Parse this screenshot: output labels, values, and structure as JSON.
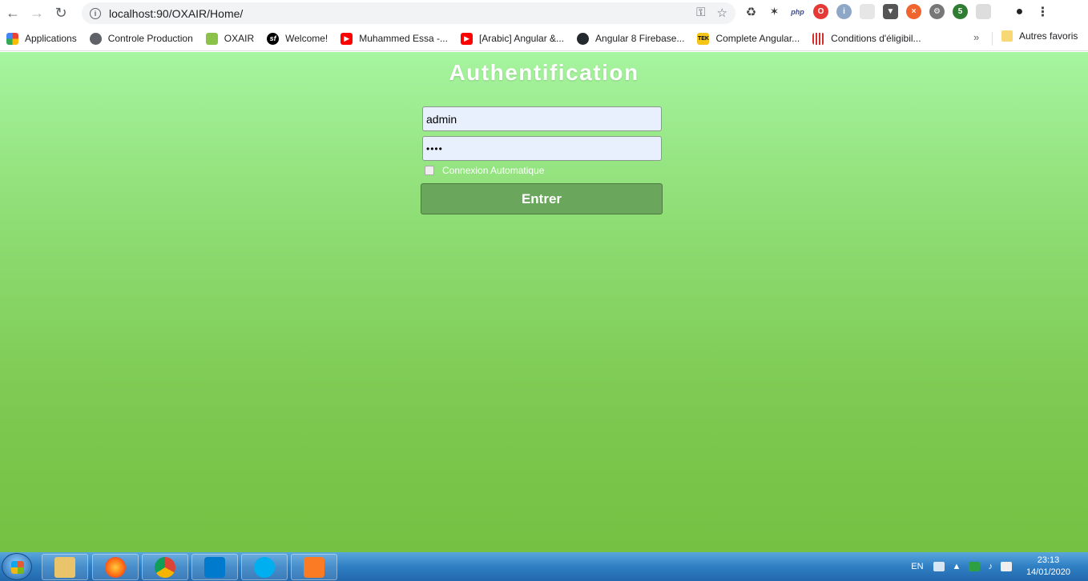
{
  "browser": {
    "url": "localhost:90/OXAIR/Home/",
    "bookmarks": [
      {
        "label": "Applications",
        "icon": "apps-grid-icon",
        "color": "#e94235"
      },
      {
        "label": "Controle Production",
        "icon": "globe-icon",
        "color": "#5f6368"
      },
      {
        "label": "OXAIR",
        "icon": "oxair-icon",
        "color": "#8bc34a"
      },
      {
        "label": "Welcome!",
        "icon": "symfony-icon",
        "color": "#000000"
      },
      {
        "label": "Muhammed Essa -...",
        "icon": "youtube-icon",
        "color": "#ff0000"
      },
      {
        "label": "[Arabic] Angular &...",
        "icon": "youtube-icon",
        "color": "#ff0000"
      },
      {
        "label": "Angular 8 Firebase...",
        "icon": "github-icon",
        "color": "#24292e"
      },
      {
        "label": "Complete Angular...",
        "icon": "tek-icon",
        "color": "#f5c518"
      },
      {
        "label": "Conditions d'éligibil...",
        "icon": "bars-icon",
        "color": "#d32f2f"
      }
    ],
    "more_label": "»",
    "other_favorites": "Autres favoris"
  },
  "login": {
    "title": "Authentification",
    "username_value": "admin",
    "password_value": "••••",
    "remember_label": "Connexion Automatique",
    "submit_label": "Entrer"
  },
  "taskbar": {
    "language": "EN",
    "time": "23:13",
    "date": "14/01/2020"
  }
}
